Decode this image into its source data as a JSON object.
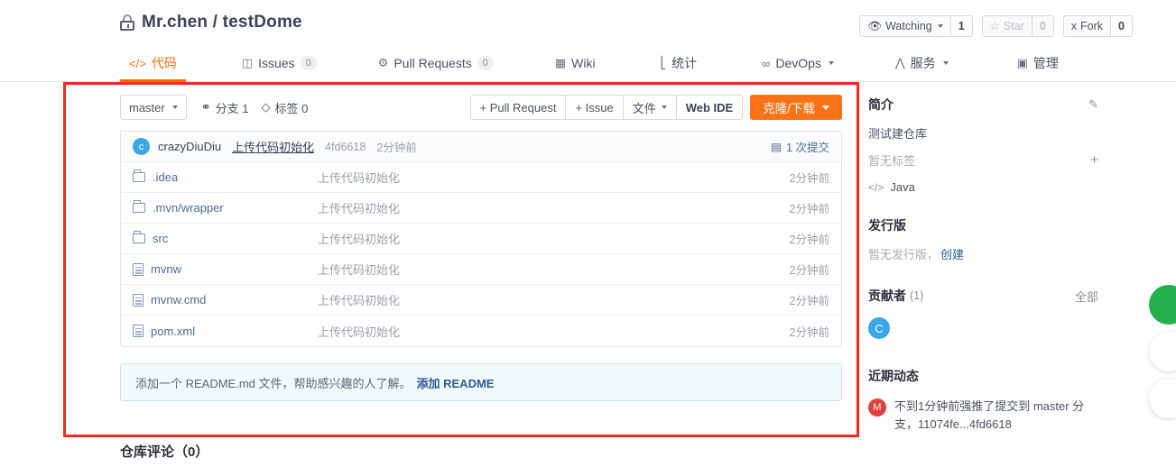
{
  "header": {
    "lock_icon": "lock-icon",
    "owner": "Mr.chen",
    "separator": "/",
    "repo": "testDome",
    "title": "Mr.chen / testDome",
    "actions": {
      "watching_label": "Watching",
      "watching_count": "1",
      "star_label": "Star",
      "star_count": "0",
      "fork_label": "Fork",
      "fork_count": "0"
    }
  },
  "nav": {
    "items": [
      {
        "label": "代码",
        "icon": "code-icon",
        "badge": "",
        "active": true
      },
      {
        "label": "Issues",
        "icon": "issue-icon",
        "badge": "0",
        "active": false
      },
      {
        "label": "Pull Requests",
        "icon": "pull-request-icon",
        "badge": "0",
        "active": false
      },
      {
        "label": "Wiki",
        "icon": "wiki-icon",
        "badge": "",
        "active": false
      },
      {
        "label": "统计",
        "icon": "chart-icon",
        "badge": "",
        "active": false
      },
      {
        "label": "DevOps",
        "icon": "infinity-icon",
        "badge": "",
        "active": false
      },
      {
        "label": "服务",
        "icon": "activity-icon",
        "badge": "",
        "active": false
      },
      {
        "label": "管理",
        "icon": "settings-icon",
        "badge": "",
        "active": false
      }
    ]
  },
  "toolbar": {
    "branch": "master",
    "branches_label": "分支 1",
    "tags_label": "标签 0",
    "pull_request_button": "+ Pull Request",
    "issue_button": "+ Issue",
    "files_button": "文件",
    "web_ide_button": "Web IDE",
    "clone_button": "克隆/下载"
  },
  "commit": {
    "avatar_letter": "c",
    "author": "crazyDiuDiu",
    "message": "上传代码初始化",
    "sha": "4fd6618",
    "time": "2分钟前",
    "commit_count": "1 次提交"
  },
  "files": {
    "rows": [
      {
        "name": ".idea",
        "type": "folder",
        "message": "上传代码初始化",
        "time": "2分钟前"
      },
      {
        "name": ".mvn/wrapper",
        "type": "folder",
        "message": "上传代码初始化",
        "time": "2分钟前"
      },
      {
        "name": "src",
        "type": "folder",
        "message": "上传代码初始化",
        "time": "2分钟前"
      },
      {
        "name": "mvnw",
        "type": "file",
        "message": "上传代码初始化",
        "time": "2分钟前"
      },
      {
        "name": "mvnw.cmd",
        "type": "file",
        "message": "上传代码初始化",
        "time": "2分钟前"
      },
      {
        "name": "pom.xml",
        "type": "file",
        "message": "上传代码初始化",
        "time": "2分钟前"
      }
    ]
  },
  "readme_banner": {
    "text": "添加一个 README.md 文件，帮助感兴趣的人了解。",
    "link": "添加 README"
  },
  "repo_comment": {
    "title": "仓库评论（0）"
  },
  "sidebar": {
    "intro": {
      "title": "简介",
      "edit_icon": "edit-icon",
      "description": "测试建仓库",
      "tags_empty": "暂无标签",
      "add_tag_icon": "plus-icon",
      "language": "Java",
      "language_icon": "code-brackets-icon"
    },
    "releases": {
      "title": "发行版",
      "empty_text": "暂无发行版，",
      "create_link": "创建"
    },
    "contributors": {
      "title": "贡献者",
      "count": "(1)",
      "all_link": "全部",
      "avatars": [
        {
          "letter": "C",
          "color": "#3ba7e8"
        }
      ]
    },
    "activity": {
      "title": "近期动态",
      "items": [
        {
          "avatar_letter": "M",
          "avatar_color": "#e0413c",
          "text": "不到1分钟前强推了提交到 master 分支，11074fe...4fd6618"
        }
      ]
    }
  },
  "annotation": {
    "shape": "rectangle",
    "color": "#ef2a1f"
  },
  "float_buttons": [
    {
      "name": "chat-fab",
      "color": "#22b14c"
    },
    {
      "name": "secondary-fab-1",
      "color": "#ffffff"
    },
    {
      "name": "secondary-fab-2",
      "color": "#ffffff"
    }
  ]
}
